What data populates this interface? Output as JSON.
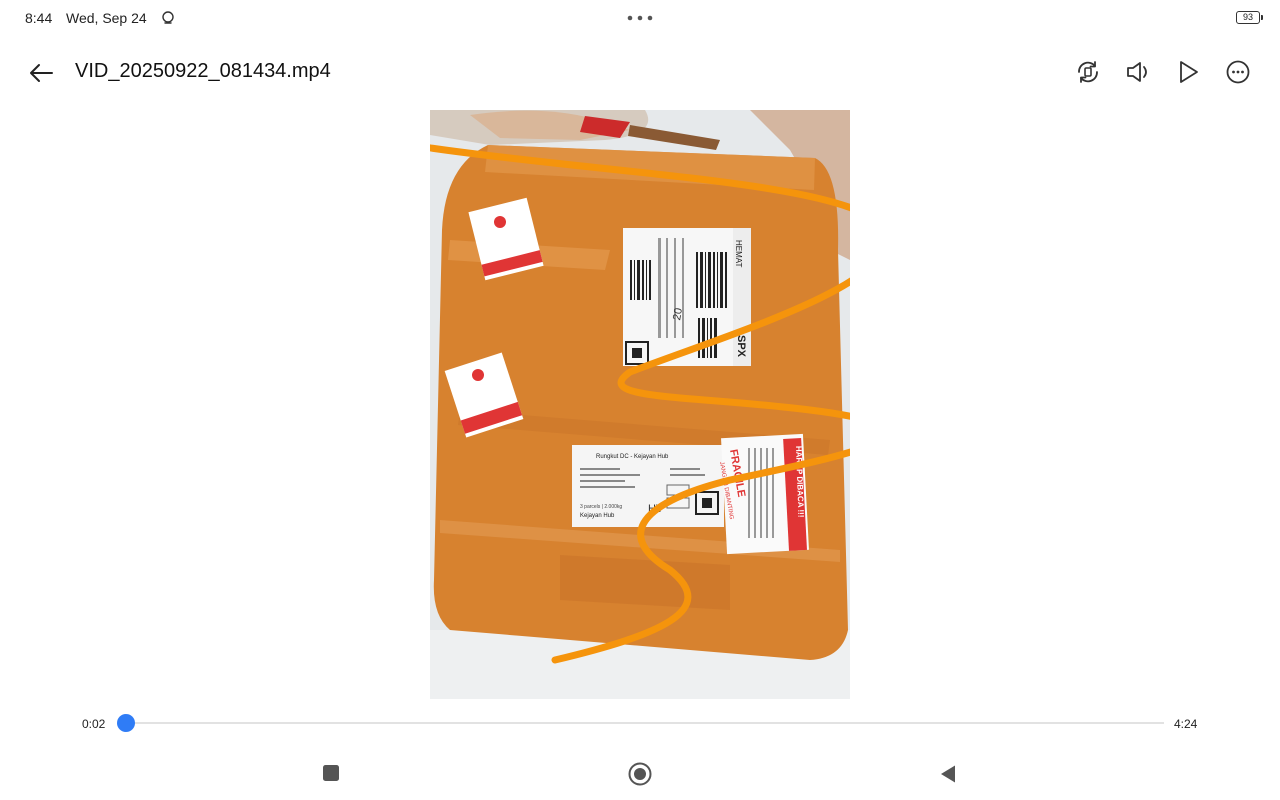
{
  "status_bar": {
    "time": "8:44",
    "date": "Wed, Sep 24",
    "battery": "93",
    "icons": [
      "alarm-icon",
      "more-dots-icon",
      "battery-icon"
    ]
  },
  "header": {
    "title": "VID_20250922_081434.mp4",
    "icons": [
      "back-arrow-icon",
      "rotate-screen-icon",
      "speaker-icon",
      "play-icon",
      "more-options-icon"
    ]
  },
  "video": {
    "scene": "orange plastic-wrapped parcel with shipping labels and FRAGILE stickers",
    "labels": {
      "sticker_warning": "HARAP DIBACA !!!",
      "sticker_fragile": "FRAGILE",
      "sticker_fragile_sub": "JANGAN DIBANTING",
      "shipping_brand": "SPX",
      "shipping_service": "HEMAT",
      "handwritten_number": "20",
      "manifest_title": "Rungkut DC - Kejayan Hub",
      "manifest_parcels": "3 parcels | 2.000kg",
      "manifest_destination": "Kejayan Hub",
      "manifest_code": "HV"
    },
    "colors": {
      "parcel": "#d7822f",
      "scribble": "#f5940c"
    }
  },
  "player": {
    "current_time": "0:02",
    "total_time": "4:24",
    "progress": 0.008,
    "accent": "#2f7cf6"
  },
  "nav_bar": {
    "icons": [
      "recents-square-icon",
      "home-circle-icon",
      "back-triangle-icon"
    ]
  }
}
